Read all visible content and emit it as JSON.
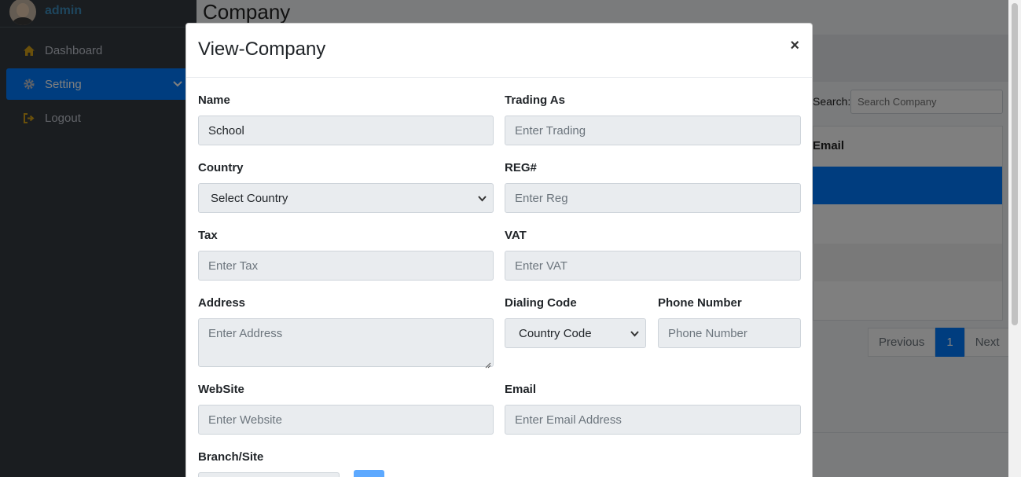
{
  "sidebar": {
    "brand": "admin",
    "items": [
      {
        "label": "Dashboard",
        "icon": "home-icon",
        "active": false
      },
      {
        "label": "Setting",
        "icon": "gear-icon",
        "active": true
      },
      {
        "label": "Logout",
        "icon": "logout-icon",
        "active": false
      }
    ]
  },
  "page": {
    "title": "Company",
    "search_label": "Search:",
    "search_placeholder": "Search Company",
    "table_header_email": "Email",
    "pagination": {
      "previous": "Previous",
      "current": "1",
      "next": "Next"
    }
  },
  "modal": {
    "title": "View-Company",
    "close": "×",
    "fields": {
      "name": {
        "label": "Name",
        "value": "School"
      },
      "trading_as": {
        "label": "Trading As",
        "placeholder": "Enter Trading"
      },
      "country": {
        "label": "Country",
        "selected": "Select Country"
      },
      "reg": {
        "label": "REG#",
        "placeholder": "Enter Reg"
      },
      "tax": {
        "label": "Tax",
        "placeholder": "Enter Tax"
      },
      "vat": {
        "label": "VAT",
        "placeholder": "Enter VAT"
      },
      "address": {
        "label": "Address",
        "placeholder": "Enter Address"
      },
      "dialing_code": {
        "label": "Dialing Code",
        "selected": "Country Code"
      },
      "phone": {
        "label": "Phone Number",
        "placeholder": "Phone Number"
      },
      "website": {
        "label": "WebSite",
        "placeholder": "Enter Website"
      },
      "email": {
        "label": "Email",
        "placeholder": "Enter Email Address"
      },
      "branch": {
        "label": "Branch/Site"
      }
    }
  },
  "colors": {
    "primary": "#007bff",
    "sidebar": "#343a40",
    "brand": "#3c8dbc"
  }
}
